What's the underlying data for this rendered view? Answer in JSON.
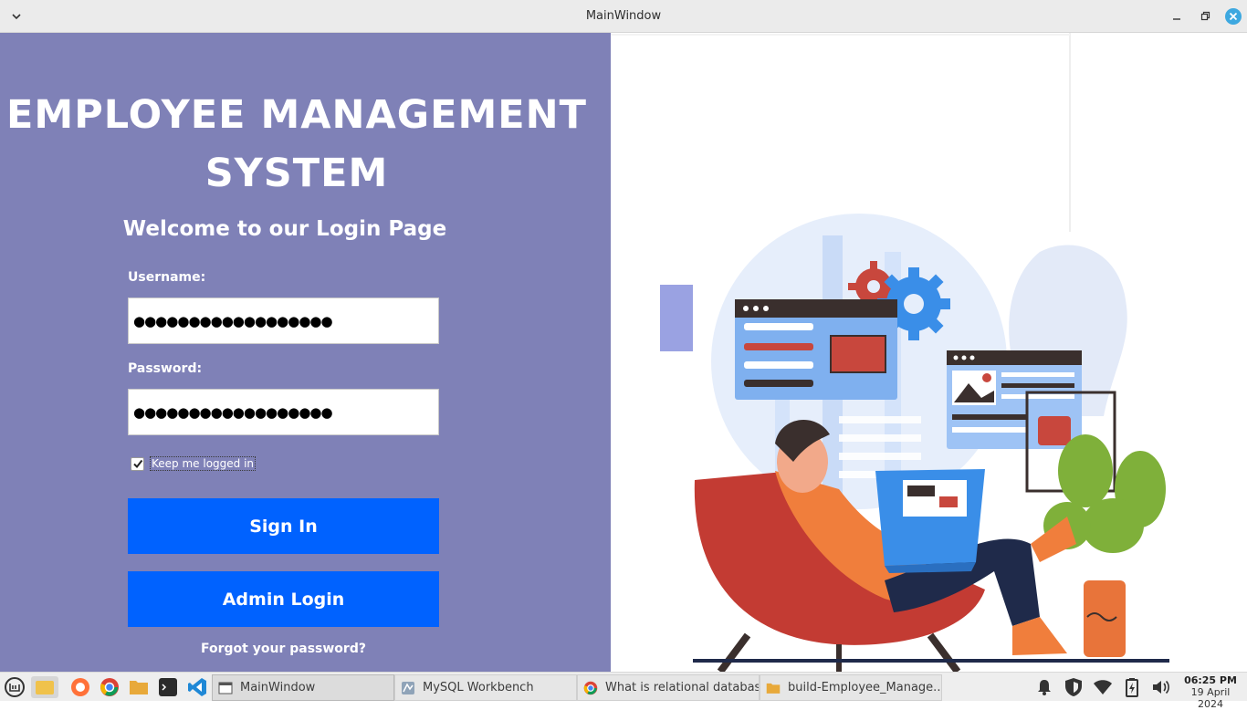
{
  "window": {
    "title": "MainWindow"
  },
  "login": {
    "app_title_line1": "EMPLOYEE MANAGEMENT",
    "app_title_line2": "SYSTEM",
    "welcome": "Welcome to our Login Page",
    "username_label": "Username:",
    "username_value": "●●●●●●●●●●●●●●●●●●",
    "password_label": "Password:",
    "password_value": "●●●●●●●●●●●●●●●●●●",
    "remember_label": "Keep me logged in",
    "remember_checked": true,
    "signin_label": "Sign In",
    "admin_label": "Admin Login",
    "forgot_label": "Forgot your password?"
  },
  "colors": {
    "panel_bg": "#7f81b7",
    "button_bg": "#0062ff",
    "close_button": "#3da8e0"
  },
  "taskbar": {
    "launchers": [
      "mint-menu-icon",
      "show-desktop-icon",
      "firefox-icon",
      "chrome-icon",
      "files-icon",
      "terminal-icon",
      "vscode-icon"
    ],
    "tasks": [
      {
        "label": "MainWindow",
        "icon": "window-icon",
        "active": true
      },
      {
        "label": "MySQL Workbench",
        "icon": "mysql-icon",
        "active": false
      },
      {
        "label": "What is relational databas...",
        "icon": "chrome-icon",
        "active": false
      },
      {
        "label": "build-Employee_Manage...",
        "icon": "folder-icon",
        "active": false
      }
    ],
    "tray": [
      "notification-bell-icon",
      "shield-icon",
      "wifi-icon",
      "battery-icon",
      "volume-icon"
    ],
    "time": "06:25 PM",
    "date": "19 April 2024"
  }
}
